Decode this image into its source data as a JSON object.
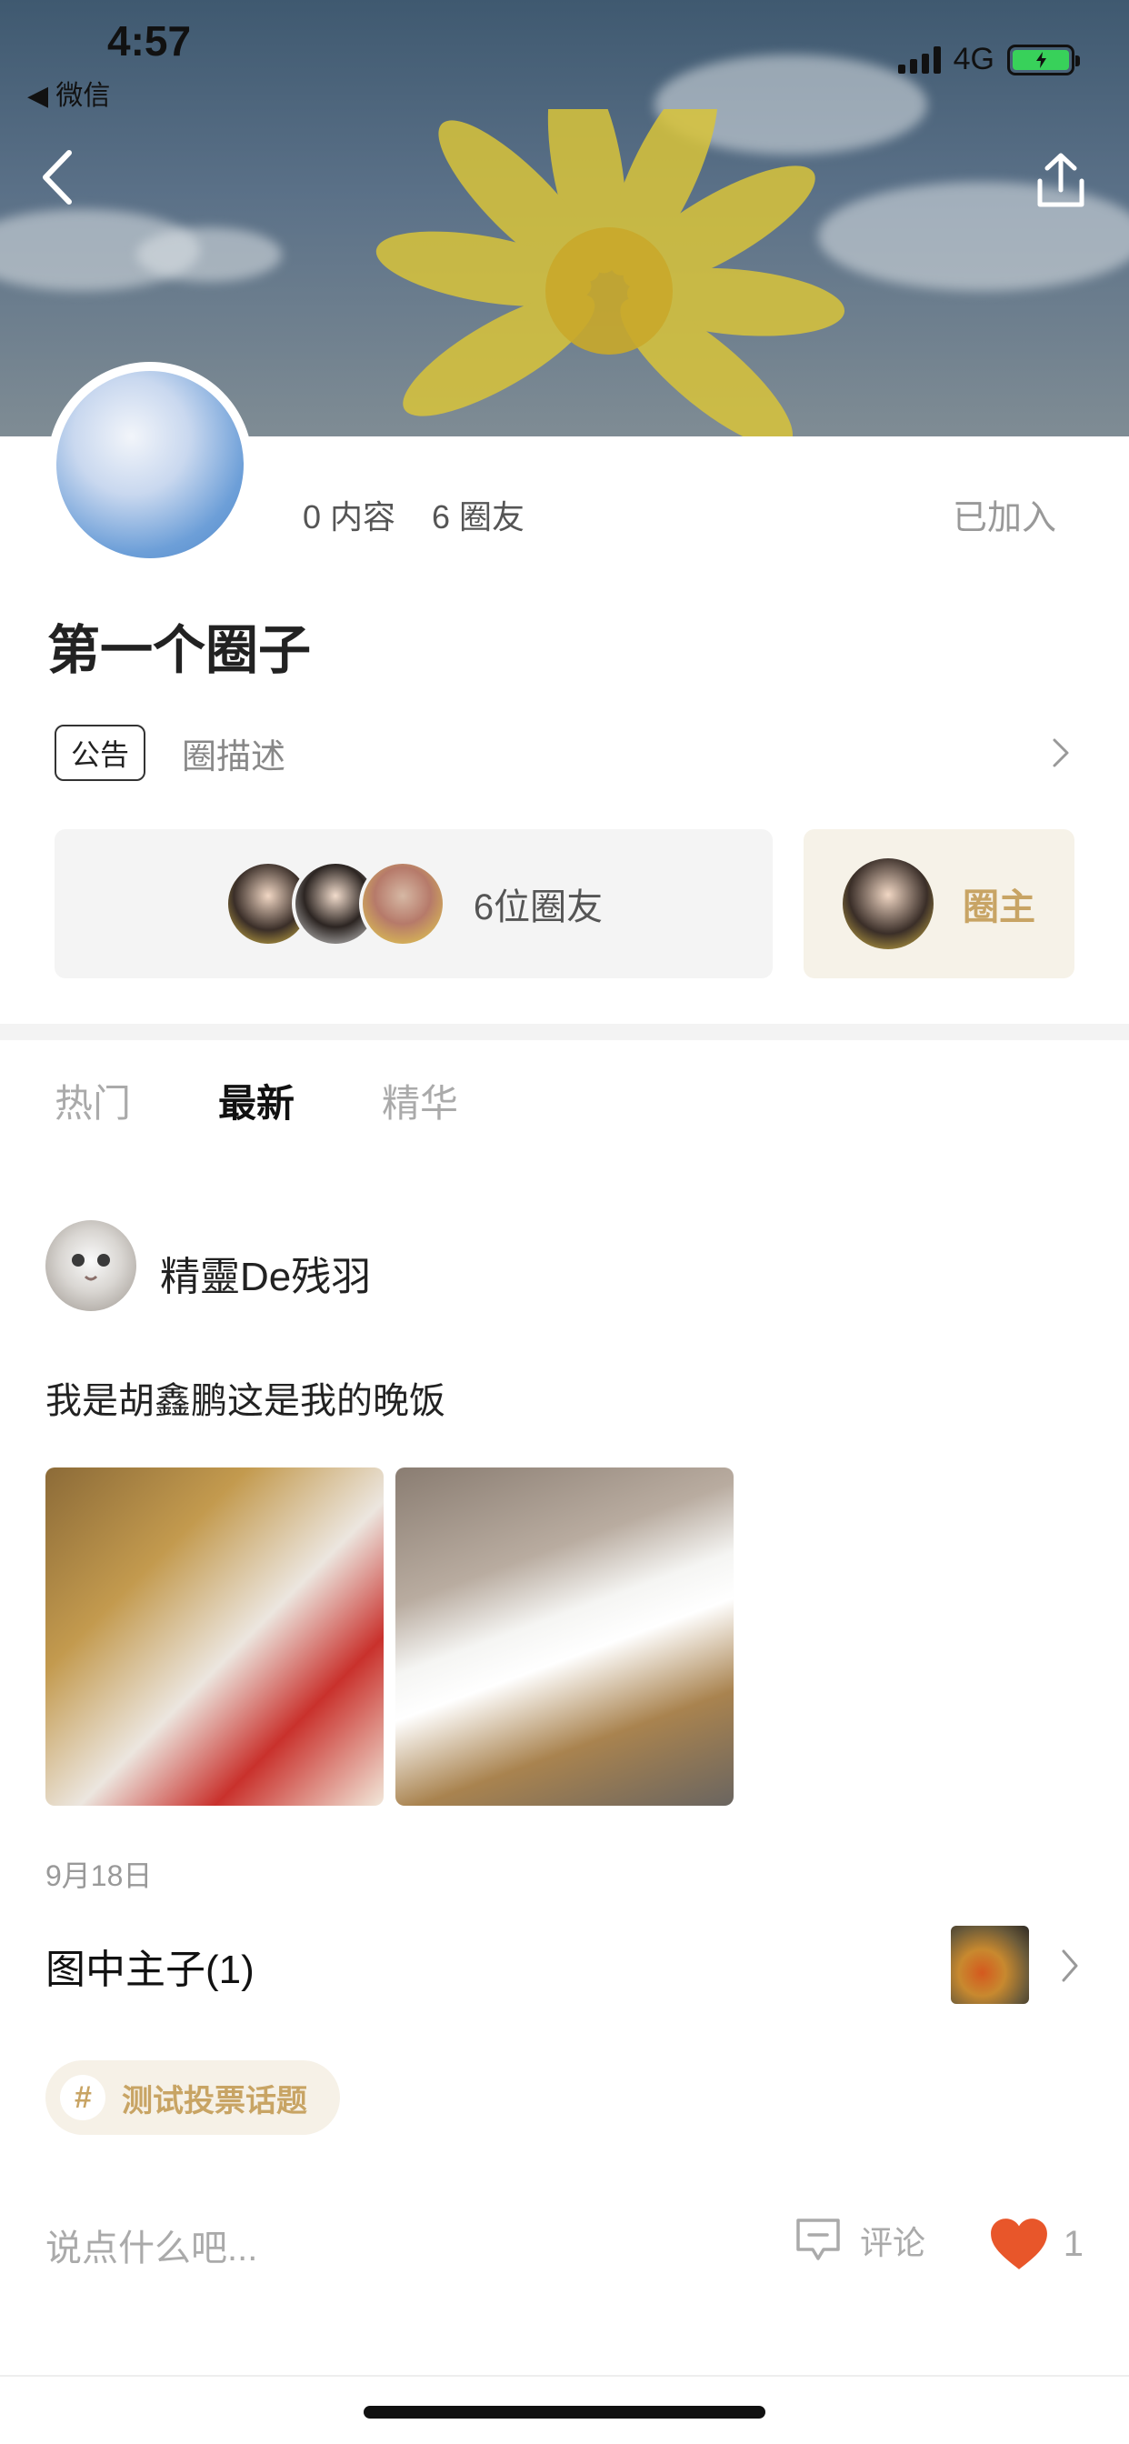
{
  "status_bar": {
    "time": "4:57",
    "back_app": "◀ 微信",
    "network": "4G"
  },
  "circle": {
    "content_count": "0 内容",
    "member_count": "6 圈友",
    "join_status": "已加入",
    "title": "第一个圈子",
    "notice_tag": "公告",
    "description": "圈描述",
    "members_label": "6位圈友",
    "owner_label": "圈主"
  },
  "tabs": [
    {
      "label": "热门",
      "active": false
    },
    {
      "label": "最新",
      "active": true
    },
    {
      "label": "精华",
      "active": false
    }
  ],
  "post": {
    "author": "精靈De残羽",
    "text": "我是胡鑫鹏这是我的晚饭",
    "date": "9月18日",
    "topic_title": "图中主子(1)",
    "hashtag_icon": "#",
    "hashtag": "测试投票话题",
    "comment_placeholder": "说点什么吧...",
    "comment_label": "评论",
    "like_count": "1"
  },
  "colors": {
    "accent_gold": "#c8a464",
    "like_orange": "#e8562a"
  },
  "icons": [
    "back-icon",
    "share-icon",
    "chevron-right-icon",
    "comment-icon",
    "heart-icon",
    "hashtag-icon"
  ]
}
